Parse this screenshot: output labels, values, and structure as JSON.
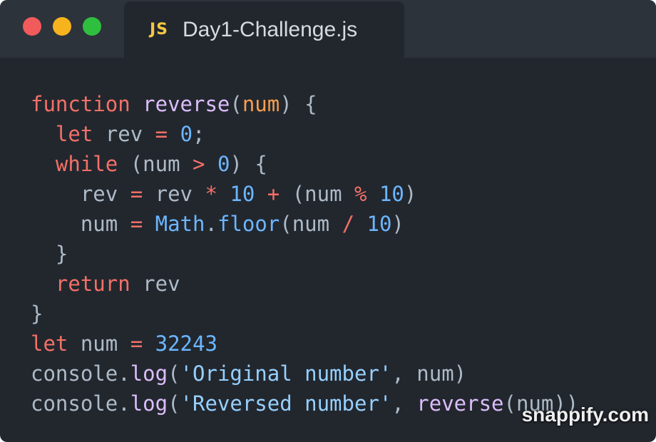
{
  "colors": {
    "background": "#22272e",
    "titlebar": "#2d333b",
    "traffic_red": "#f15b5b",
    "traffic_yellow": "#f6b31d",
    "traffic_green": "#2fbf3f",
    "js_icon": "#f5c742",
    "plain": "#adbac7",
    "keyword": "#f47067",
    "function_name": "#dcbdfb",
    "parameter": "#f69d50",
    "number": "#6cb6ff",
    "string": "#96d0ff"
  },
  "window": {
    "controls": [
      "close-icon",
      "minimize-icon",
      "maximize-icon"
    ]
  },
  "tab": {
    "icon": "JS",
    "icon_name": "javascript-file-icon",
    "filename": "Day1-Challenge.js"
  },
  "code": {
    "language": "javascript",
    "lines": [
      [
        [
          "keyword",
          "function"
        ],
        [
          "plain",
          " "
        ],
        [
          "function_name",
          "reverse"
        ],
        [
          "plain",
          "("
        ],
        [
          "parameter",
          "num"
        ],
        [
          "plain",
          ") {"
        ]
      ],
      [
        [
          "plain",
          "  "
        ],
        [
          "keyword",
          "let"
        ],
        [
          "plain",
          " rev "
        ],
        [
          "keyword",
          "="
        ],
        [
          "plain",
          " "
        ],
        [
          "number",
          "0"
        ],
        [
          "plain",
          ";"
        ]
      ],
      [
        [
          "plain",
          "  "
        ],
        [
          "keyword",
          "while"
        ],
        [
          "plain",
          " (num "
        ],
        [
          "keyword",
          ">"
        ],
        [
          "plain",
          " "
        ],
        [
          "number",
          "0"
        ],
        [
          "plain",
          ") {"
        ]
      ],
      [
        [
          "plain",
          "    rev "
        ],
        [
          "keyword",
          "="
        ],
        [
          "plain",
          " rev "
        ],
        [
          "keyword",
          "*"
        ],
        [
          "plain",
          " "
        ],
        [
          "number",
          "10"
        ],
        [
          "plain",
          " "
        ],
        [
          "keyword",
          "+"
        ],
        [
          "plain",
          " (num "
        ],
        [
          "keyword",
          "%"
        ],
        [
          "plain",
          " "
        ],
        [
          "number",
          "10"
        ],
        [
          "plain",
          ")"
        ]
      ],
      [
        [
          "plain",
          "    num "
        ],
        [
          "keyword",
          "="
        ],
        [
          "plain",
          " "
        ],
        [
          "number",
          "Math"
        ],
        [
          "plain",
          "."
        ],
        [
          "number",
          "floor"
        ],
        [
          "plain",
          "(num "
        ],
        [
          "keyword",
          "/"
        ],
        [
          "plain",
          " "
        ],
        [
          "number",
          "10"
        ],
        [
          "plain",
          ")"
        ]
      ],
      [
        [
          "plain",
          "  }"
        ]
      ],
      [
        [
          "plain",
          "  "
        ],
        [
          "keyword",
          "return"
        ],
        [
          "plain",
          " rev"
        ]
      ],
      [
        [
          "plain",
          "}"
        ]
      ],
      [
        [
          "keyword",
          "let"
        ],
        [
          "plain",
          " num "
        ],
        [
          "keyword",
          "="
        ],
        [
          "plain",
          " "
        ],
        [
          "number",
          "32243"
        ]
      ],
      [
        [
          "plain",
          "console."
        ],
        [
          "function_name",
          "log"
        ],
        [
          "plain",
          "("
        ],
        [
          "string",
          "'Original number'"
        ],
        [
          "plain",
          ", num)"
        ]
      ],
      [
        [
          "plain",
          "console."
        ],
        [
          "function_name",
          "log"
        ],
        [
          "plain",
          "("
        ],
        [
          "string",
          "'Reversed number'"
        ],
        [
          "plain",
          ", "
        ],
        [
          "function_name",
          "reverse"
        ],
        [
          "plain",
          "(num))"
        ]
      ]
    ]
  },
  "watermark": "snappify.com"
}
